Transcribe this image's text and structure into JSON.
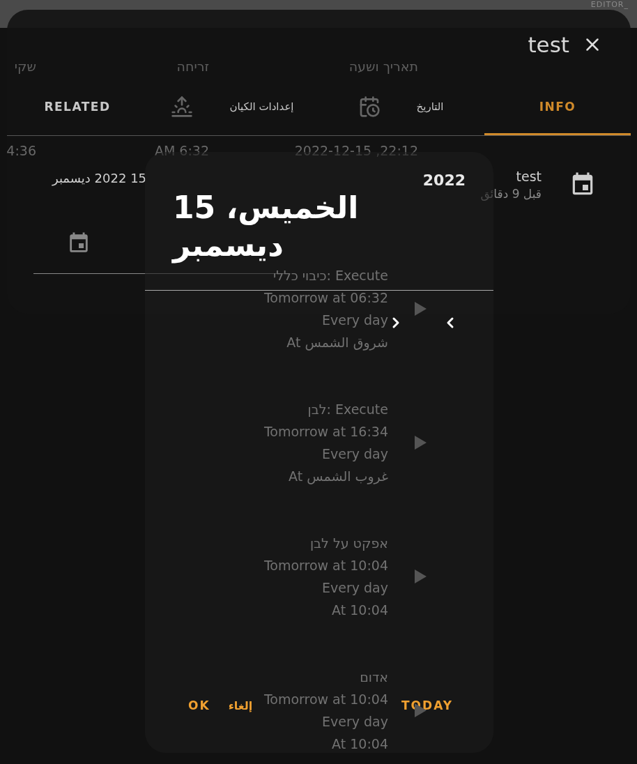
{
  "background_page": {
    "top_bar_text": "EDITOR_",
    "columns": [
      "תאריך ושעה",
      "זריחה",
      "שקי"
    ],
    "row": [
      "2022-12-15 ,22:12",
      "AM 6:32",
      "4:36"
    ]
  },
  "dialog": {
    "title": "test",
    "tabs": [
      {
        "label": "INFO",
        "selected": true
      },
      {
        "label": "التاريخ",
        "selected": false
      },
      {
        "label": "إعدادات الكيان",
        "selected": false
      },
      {
        "label": "RELATED",
        "selected": false
      }
    ],
    "entry": {
      "name": "test",
      "time": "قبل 9 دقائق"
    },
    "date_value": "15 2022 ديسمبر"
  },
  "schedule": [
    {
      "title": "כיבוי כללי: Execute",
      "next": "Tomorrow at 06:32",
      "repeat": "Every day",
      "at": "At شروق الشمس"
    },
    {
      "title": "לבן: Execute",
      "next": "Tomorrow at 16:34",
      "repeat": "Every day",
      "at": "At غروب الشمس"
    },
    {
      "title": "אפקט על לבן",
      "next": "Tomorrow at 10:04",
      "repeat": "Every day",
      "at": "At 10:04"
    },
    {
      "title": "אדום",
      "next": "Tomorrow at 10:04",
      "repeat": "Every day",
      "at": "At 10:04"
    }
  ],
  "date_picker": {
    "year": "2022",
    "date": "الخميس، 15 ديسمبر",
    "buttons": [
      "TODAY",
      "إلغاء",
      "OK"
    ]
  }
}
